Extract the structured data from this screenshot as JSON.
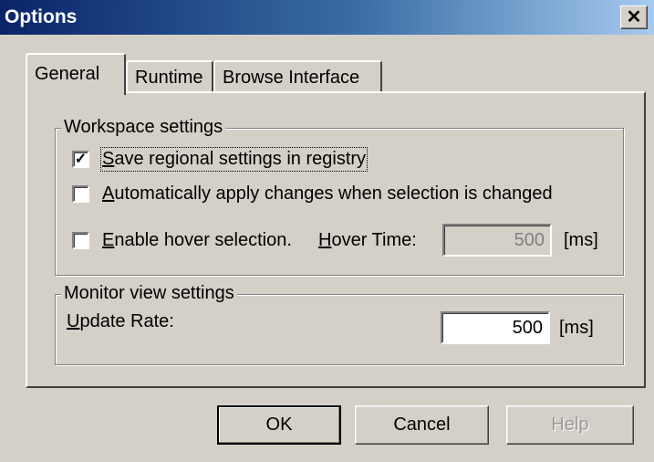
{
  "window": {
    "title": "Options",
    "close_glyph": "✕"
  },
  "tabs": [
    {
      "label": "General",
      "active": true
    },
    {
      "label": "Runtime",
      "active": false
    },
    {
      "label": "Browse Interface",
      "active": false
    }
  ],
  "workspace": {
    "legend": "Workspace settings",
    "save_regional": {
      "mnemonic": "S",
      "rest": "ave regional settings in registry",
      "checked": true
    },
    "auto_apply": {
      "mnemonic": "A",
      "rest": "utomatically apply changes when selection is changed",
      "checked": false
    },
    "hover": {
      "mnemonic": "E",
      "rest": "nable hover selection.",
      "checked": false,
      "time_mnemonic": "H",
      "time_rest": "over Time:",
      "time_value": "500",
      "time_unit": "[ms]"
    }
  },
  "monitor": {
    "legend": "Monitor view settings",
    "update_mnemonic": "U",
    "update_rest": "pdate Rate:",
    "update_value": "500",
    "update_unit": "[ms]"
  },
  "buttons": {
    "ok": "OK",
    "cancel": "Cancel",
    "help": "Help"
  }
}
